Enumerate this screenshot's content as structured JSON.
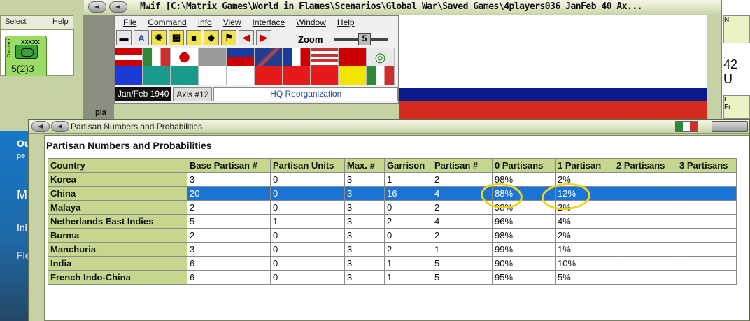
{
  "map_window": {
    "title": "Mwif [C:\\Matrix Games\\World in Flames\\Scenarios\\Global War\\Saved Games\\4players036 JanFeb 40 Ax...",
    "select_label": "Select",
    "help_label": "Help",
    "menu": [
      "File",
      "Command",
      "Info",
      "View",
      "Interface",
      "Window",
      "Help"
    ],
    "zoom_label": "Zoom",
    "zoom_value": "5",
    "date": "Jan/Feb 1940",
    "turn": "Axis #12",
    "phase": "HQ Reorganization",
    "side_label": "pia",
    "right_text": "42 U",
    "right_n": "N",
    "right_e": "E",
    "right_f": "Fr"
  },
  "unit_counter": {
    "commander": "Graziani",
    "size": "XXXXX",
    "strength": "5(2)3",
    "color": "#9bdc64"
  },
  "background_panel": {
    "lines": [
      "Ou",
      "pe",
      "M",
      "Inl",
      "Fle"
    ]
  },
  "dialog": {
    "title": "Partisan Numbers and Probabilities",
    "heading": "Partisan Numbers and Probabilities",
    "columns": [
      "Country",
      "Base Partisan #",
      "Partisan Units",
      "Max. #",
      "Garrison",
      "Partisan #",
      "0 Partisans",
      "1 Partisan",
      "2 Partisans",
      "3 Partisans"
    ],
    "selected_row": "China",
    "rows": [
      [
        "Korea",
        "3",
        "0",
        "3",
        "1",
        "2",
        "98%",
        "2%",
        "-",
        "-"
      ],
      [
        "China",
        "20",
        "0",
        "3",
        "16",
        "4",
        "88%",
        "12%",
        "-",
        "-"
      ],
      [
        "Malaya",
        "2",
        "0",
        "3",
        "0",
        "2",
        "98%",
        "2%",
        "-",
        "-"
      ],
      [
        "Netherlands East Indies",
        "5",
        "1",
        "3",
        "2",
        "4",
        "96%",
        "4%",
        "-",
        "-"
      ],
      [
        "Burma",
        "2",
        "0",
        "3",
        "0",
        "2",
        "98%",
        "2%",
        "-",
        "-"
      ],
      [
        "Manchuria",
        "3",
        "0",
        "3",
        "2",
        "1",
        "99%",
        "1%",
        "-",
        "-"
      ],
      [
        "India",
        "6",
        "0",
        "3",
        "1",
        "5",
        "90%",
        "10%",
        "-",
        "-"
      ],
      [
        "French Indo-China",
        "6",
        "0",
        "3",
        "1",
        "5",
        "95%",
        "5%",
        "-",
        "-"
      ]
    ]
  },
  "colors": {
    "header_bg": "#c5d68e",
    "selection": "#1a74d6",
    "annotation": "#f2d31b"
  }
}
